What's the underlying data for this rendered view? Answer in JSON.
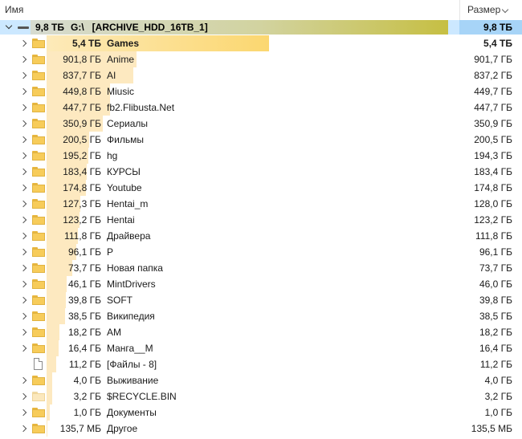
{
  "header": {
    "name_label": "Имя",
    "size_label": "Размер"
  },
  "root": {
    "size_label": "9,8 ТБ",
    "path": "G:\\   [ARCHIVE_HDD_16TB_1]",
    "size": "9,8 ТБ"
  },
  "max_size_gb": 5529.6,
  "rows": [
    {
      "size_left": "5,4 ТБ",
      "name": "Games",
      "size_right": "5,4 ТБ",
      "gb": 5529.6,
      "icon": "folder-icon",
      "bold": true
    },
    {
      "size_left": "901,8 ГБ",
      "name": "Anime",
      "size_right": "901,7 ГБ",
      "gb": 901.8,
      "icon": "folder-icon"
    },
    {
      "size_left": "837,7 ГБ",
      "name": "AI",
      "size_right": "837,2 ГБ",
      "gb": 837.7,
      "icon": "folder-icon"
    },
    {
      "size_left": "449,8 ГБ",
      "name": "Miusic",
      "size_right": "449,7 ГБ",
      "gb": 449.8,
      "icon": "folder-icon"
    },
    {
      "size_left": "447,7 ГБ",
      "name": "fb2.Flibusta.Net",
      "size_right": "447,7 ГБ",
      "gb": 447.7,
      "icon": "folder-icon"
    },
    {
      "size_left": "350,9 ГБ",
      "name": "Сериалы",
      "size_right": "350,9 ГБ",
      "gb": 350.9,
      "icon": "folder-icon"
    },
    {
      "size_left": "200,5 ГБ",
      "name": "Фильмы",
      "size_right": "200,5 ГБ",
      "gb": 200.5,
      "icon": "folder-icon"
    },
    {
      "size_left": "195,2 ГБ",
      "name": "hg",
      "size_right": "194,3 ГБ",
      "gb": 195.2,
      "icon": "folder-icon"
    },
    {
      "size_left": "183,4 ГБ",
      "name": "КУРСЫ",
      "size_right": "183,4 ГБ",
      "gb": 183.4,
      "icon": "folder-icon"
    },
    {
      "size_left": "174,8 ГБ",
      "name": "Youtube",
      "size_right": "174,8 ГБ",
      "gb": 174.8,
      "icon": "folder-icon"
    },
    {
      "size_left": "127,3 ГБ",
      "name": "Hentai_m",
      "size_right": "128,0 ГБ",
      "gb": 127.3,
      "icon": "folder-icon"
    },
    {
      "size_left": "123,2 ГБ",
      "name": "Hentai",
      "size_right": "123,2 ГБ",
      "gb": 123.2,
      "icon": "folder-icon"
    },
    {
      "size_left": "111,8 ГБ",
      "name": "Драйвера",
      "size_right": "111,8 ГБ",
      "gb": 111.8,
      "icon": "folder-icon"
    },
    {
      "size_left": "96,1 ГБ",
      "name": "P",
      "size_right": "96,1 ГБ",
      "gb": 96.1,
      "icon": "folder-icon"
    },
    {
      "size_left": "73,7 ГБ",
      "name": "Новая папка",
      "size_right": "73,7 ГБ",
      "gb": 73.7,
      "icon": "folder-icon"
    },
    {
      "size_left": "46,1 ГБ",
      "name": "MintDrivers",
      "size_right": "46,0 ГБ",
      "gb": 46.1,
      "icon": "folder-icon"
    },
    {
      "size_left": "39,8 ГБ",
      "name": "SOFT",
      "size_right": "39,8 ГБ",
      "gb": 39.8,
      "icon": "folder-icon"
    },
    {
      "size_left": "38,5 ГБ",
      "name": "Википедия",
      "size_right": "38,5 ГБ",
      "gb": 38.5,
      "icon": "folder-icon"
    },
    {
      "size_left": "18,2 ГБ",
      "name": "AM",
      "size_right": "18,2 ГБ",
      "gb": 18.2,
      "icon": "folder-icon"
    },
    {
      "size_left": "16,4 ГБ",
      "name": "Манга__M",
      "size_right": "16,4 ГБ",
      "gb": 16.4,
      "icon": "folder-icon"
    },
    {
      "size_left": "11,2 ГБ",
      "name": "[Файлы - 8]",
      "size_right": "11,2 ГБ",
      "gb": 11.2,
      "icon": "file-icon"
    },
    {
      "size_left": "4,0 ГБ",
      "name": "Выживание",
      "size_right": "4,0 ГБ",
      "gb": 4.0,
      "icon": "folder-icon"
    },
    {
      "size_left": "3,2 ГБ",
      "name": "$RECYCLE.BIN",
      "size_right": "3,2 ГБ",
      "gb": 3.2,
      "icon": "folder-icon-light"
    },
    {
      "size_left": "1,0 ГБ",
      "name": "Документы",
      "size_right": "1,0 ГБ",
      "gb": 1.0,
      "icon": "folder-icon"
    },
    {
      "size_left": "135,7 МБ",
      "name": "Другое",
      "size_right": "135,5 МБ",
      "gb": 0.13,
      "icon": "folder-icon"
    }
  ]
}
